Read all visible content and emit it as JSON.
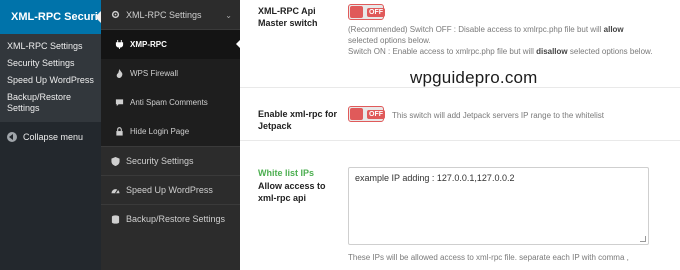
{
  "wp_sidebar": {
    "plugin_title": "XML-RPC Security",
    "items": [
      {
        "label": "XML-RPC Settings"
      },
      {
        "label": "Security Settings"
      },
      {
        "label": "Speed Up WordPress"
      },
      {
        "label": "Backup/Restore Settings"
      }
    ],
    "collapse_label": "Collapse menu"
  },
  "plugin_nav": {
    "section": "XML-RPC Settings",
    "sub_items": [
      {
        "label": "XMP-RPC",
        "active": true
      },
      {
        "label": "WPS Firewall"
      },
      {
        "label": "Anti Spam Comments"
      },
      {
        "label": "Hide Login Page"
      }
    ],
    "main_items": [
      {
        "label": "Security Settings"
      },
      {
        "label": "Speed Up WordPress"
      },
      {
        "label": "Backup/Restore Settings"
      }
    ]
  },
  "settings": {
    "api_master": {
      "label": "XML-RPC Api Master switch",
      "toggle": "OFF",
      "desc_line1_a": "(Recommended) Switch OFF : Disable access to xmlrpc.php file but will ",
      "desc_line1_b": "allow",
      "desc_line1_c": " selected options below.",
      "desc_line2_a": "Switch ON : Enable access to xmlrpc.php file but will ",
      "desc_line2_b": "disallow",
      "desc_line2_c": " selected options below."
    },
    "jetpack": {
      "label": "Enable xml-rpc for Jetpack",
      "toggle": "OFF",
      "desc": "This switch will add Jetpack servers IP range to the whitelist"
    },
    "whitelist": {
      "title": "White list IPs",
      "subtitle": "Allow access to xml-rpc api",
      "textarea_value": "example IP adding : 127.0.0.1,127.0.0.2",
      "note": "These IPs will be allowed access to xml-rpc file. separate each IP with comma ,"
    }
  },
  "watermark": "wpguidepro.com",
  "colors": {
    "wp_sidebar_bg": "#23282d",
    "wp_active_bg": "#0073aa",
    "plugin_nav_bg": "#2c2c2c",
    "toggle_off": "#e05a5a",
    "whitelist_title": "#4caf50"
  }
}
